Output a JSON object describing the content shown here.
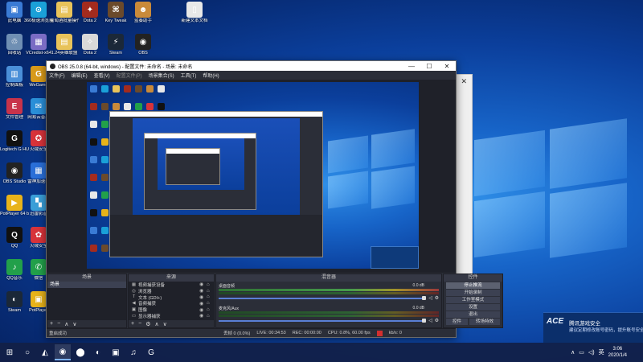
{
  "desktop": {
    "icons": [
      {
        "label": "此电脑",
        "color": "#3a7bd5",
        "glyph": "▣"
      },
      {
        "label": "360极速浏览器",
        "color": "#1aa0d8",
        "glyph": "⊙"
      },
      {
        "label": "葡萄酒批量操作器",
        "color": "#e8c35a",
        "glyph": "▤"
      },
      {
        "label": "Dota 2",
        "color": "#a32b1e",
        "glyph": "✦"
      },
      {
        "label": "Key Tweak",
        "color": "#6b4a2b",
        "glyph": "⌘"
      },
      {
        "label": "蓝奏助手",
        "color": "#c98a3a",
        "glyph": "☻"
      },
      {
        "label": "新建文本文档",
        "color": "#e8e8e8",
        "glyph": "▯"
      },
      {
        "label": "回收站",
        "color": "#6f8fb3",
        "glyph": "♲"
      },
      {
        "label": "VCredist-x64",
        "color": "#7a6cc4",
        "glyph": "▦"
      },
      {
        "label": "1.24英雄联盟",
        "color": "#e8c35a",
        "glyph": "▤"
      },
      {
        "label": "Dota 2",
        "color": "#d8d8d8",
        "glyph": "✧"
      },
      {
        "label": "Steam",
        "color": "#1b2838",
        "glyph": "⚡"
      },
      {
        "label": "OBS",
        "color": "#222",
        "glyph": "◉"
      },
      {
        "label": "控制面板",
        "color": "#4a8fd8",
        "glyph": "▥"
      },
      {
        "label": "WeGame",
        "color": "#d89a1a",
        "glyph": "G"
      },
      {
        "label": "文件管理",
        "color": "#c8334a",
        "glyph": "E"
      },
      {
        "label": "网易云音乐",
        "color": "#2a8fd8",
        "glyph": "✉"
      },
      {
        "label": "Logitech G HUB",
        "color": "#111",
        "glyph": "G"
      },
      {
        "label": "火绒安全",
        "color": "#d8333a",
        "glyph": "✪"
      },
      {
        "label": "OBS Studio",
        "color": "#222",
        "glyph": "◉"
      },
      {
        "label": "雷神加速器",
        "color": "#2a6fd8",
        "glyph": "▦"
      },
      {
        "label": "PotPlayer 64 bit",
        "color": "#e8b31a",
        "glyph": "▶"
      },
      {
        "label": "迅雷影音",
        "color": "#3a9fd8",
        "glyph": "▚"
      },
      {
        "label": "QQ",
        "color": "#111",
        "glyph": "Q"
      },
      {
        "label": "火绒安全",
        "color": "#d8333a",
        "glyph": "✿"
      },
      {
        "label": "QQ音乐",
        "color": "#22a04a",
        "glyph": "♪"
      },
      {
        "label": "微信",
        "color": "#22a04a",
        "glyph": "✆"
      },
      {
        "label": "Steam",
        "color": "#1b2838",
        "glyph": "◐"
      },
      {
        "label": "PotPlayer",
        "color": "#e8b31a",
        "glyph": "▣"
      }
    ]
  },
  "obs": {
    "title": "OBS 25.0.8 (64-bit, windows) - 配置文件: 未命名 - 场景: 未命名",
    "menu": [
      "文件(F)",
      "编辑(E)",
      "查看(V)",
      "配置文件(P)",
      "场景集合(S)",
      "工具(T)",
      "帮助(H)"
    ],
    "window_controls": [
      "—",
      "☐",
      "✕"
    ],
    "docks": {
      "scenes": {
        "title": "场景",
        "items": [
          "场景"
        ],
        "footer": [
          "+",
          "−",
          "∧",
          "∨"
        ]
      },
      "sources": {
        "title": "来源",
        "items": [
          {
            "icon": "▦",
            "label": "视频捕获设备"
          },
          {
            "icon": "◎",
            "label": "浏览器"
          },
          {
            "icon": "T",
            "label": "文本 (GDI+)"
          },
          {
            "icon": "◀",
            "label": "音频捕获"
          },
          {
            "icon": "▣",
            "label": "图像"
          },
          {
            "icon": "▭",
            "label": "显示器捕获"
          }
        ],
        "footer": [
          "+",
          "−",
          "⚙",
          "∧",
          "∨"
        ]
      },
      "mixer": {
        "title": "混音器",
        "channels": [
          {
            "name": "桌面音频",
            "db": "0.0 dB"
          },
          {
            "name": "麦克风/Aux",
            "db": "0.0 dB"
          }
        ]
      },
      "controls": {
        "title": "控件",
        "buttons": [
          "停止推流",
          "开始录制",
          "工作室模式",
          "设置",
          "退出"
        ]
      }
    },
    "dock_tabs": {
      "controls": "控件",
      "transition": "转场特效"
    },
    "status": {
      "left": "重启成功",
      "dropped": "丢帧 0 (0.0%)",
      "live": "LIVE: 00:34:53",
      "rec": "REC: 00:00:00",
      "cpu": "CPU: 0.8%, 60.00 fps",
      "kbps": "kb/s: 0"
    }
  },
  "toast": {
    "brand": "ACE",
    "title": "腾讯游戏安全",
    "message": "建议定期修改账号密码，提升账号安全"
  },
  "taskbar": {
    "icons": [
      "⊞",
      "○",
      "◭",
      "◉",
      "⬤",
      "◐",
      "▣",
      "♫",
      "G"
    ],
    "tray": {
      "chevron": "∧",
      "network": "▭",
      "volume": "◁)",
      "ime": "英",
      "time": "3:06",
      "date": "2020/1/4"
    }
  },
  "colors": {
    "obs_bg": "#2b2e38",
    "accent": "#5a7fd6",
    "live_red": "#d32f2f"
  }
}
